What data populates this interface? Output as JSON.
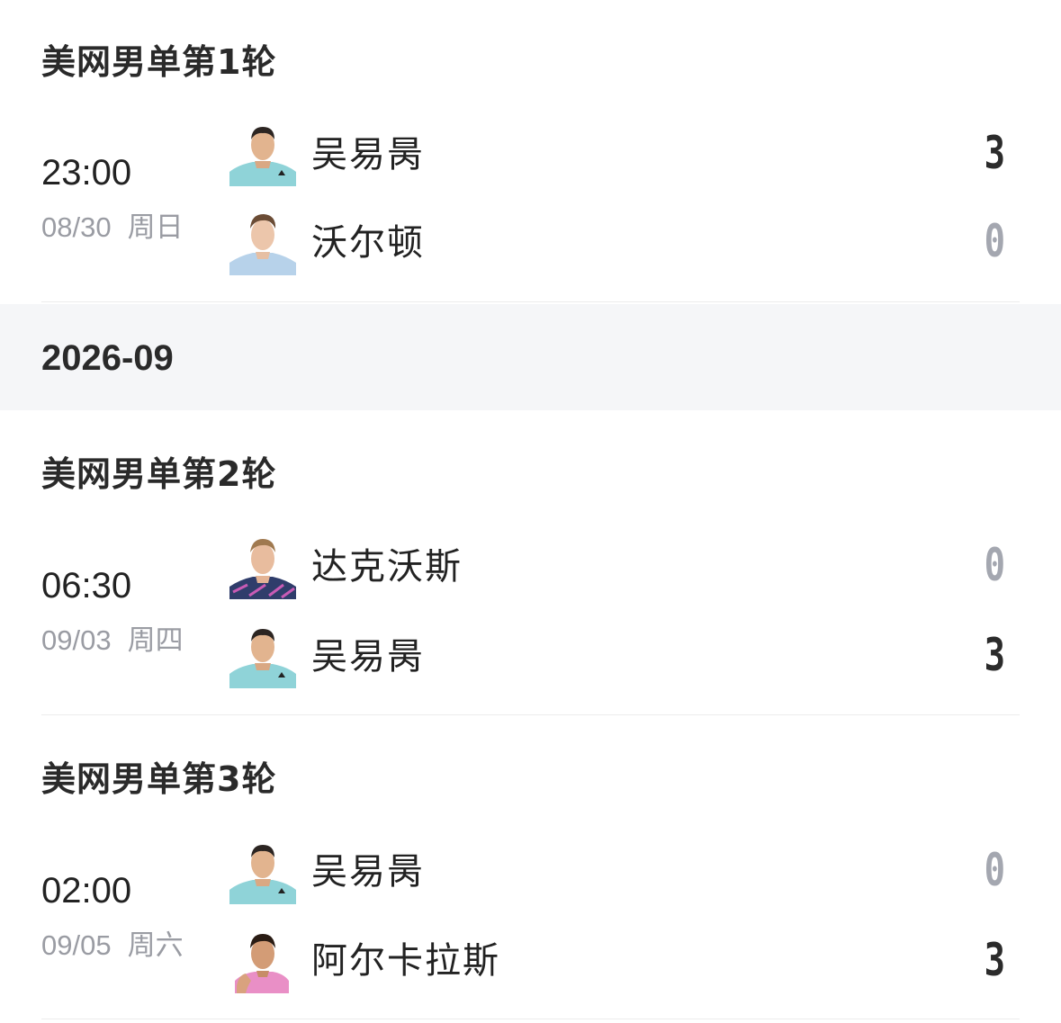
{
  "sections": [
    {
      "round": "美网男单第1轮",
      "time": "23:00",
      "date": "08/30",
      "weekday": "周日",
      "players": [
        {
          "name": "吴易昺",
          "score": "3",
          "result": "win",
          "avatar": "wu-yibing-avatar"
        },
        {
          "name": "沃尔顿",
          "score": "0",
          "result": "lose",
          "avatar": "walton-avatar"
        }
      ]
    },
    {
      "round": "美网男单第2轮",
      "time": "06:30",
      "date": "09/03",
      "weekday": "周四",
      "players": [
        {
          "name": "达克沃斯",
          "score": "0",
          "result": "lose",
          "avatar": "duckworth-avatar"
        },
        {
          "name": "吴易昺",
          "score": "3",
          "result": "win",
          "avatar": "wu-yibing-avatar"
        }
      ]
    },
    {
      "round": "美网男单第3轮",
      "time": "02:00",
      "date": "09/05",
      "weekday": "周六",
      "players": [
        {
          "name": "吴易昺",
          "score": "0",
          "result": "lose",
          "avatar": "wu-yibing-avatar"
        },
        {
          "name": "阿尔卡拉斯",
          "score": "3",
          "result": "win",
          "avatar": "alcaraz-avatar"
        }
      ]
    }
  ],
  "month_header": "2026-09",
  "colors": {
    "win_score": "#2b2b2b",
    "lose_score": "#a4a7b0",
    "date_text": "#9a9ca3",
    "band_bg": "#f5f6f8",
    "divider": "#ececec"
  }
}
